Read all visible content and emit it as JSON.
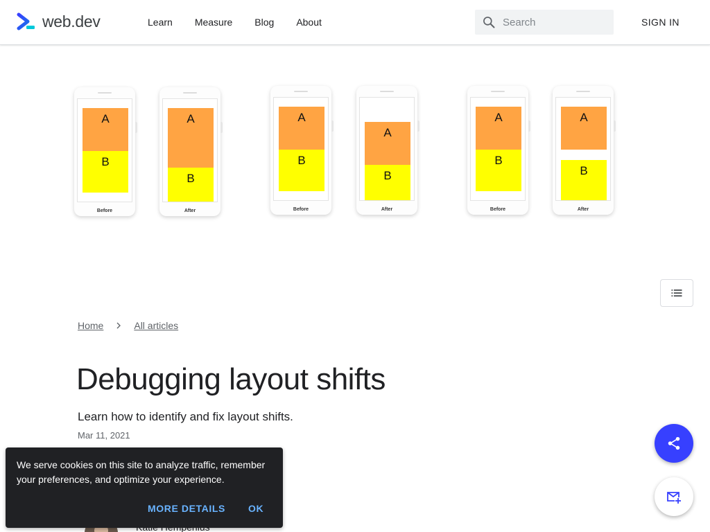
{
  "brand": {
    "name": "web.dev",
    "accent": "#3740ff",
    "logo_teal": "#00c9db"
  },
  "nav": {
    "items": [
      "Learn",
      "Measure",
      "Blog",
      "About"
    ]
  },
  "search": {
    "placeholder": "Search",
    "icon": "search-icon"
  },
  "header": {
    "signin_label": "SIGN IN"
  },
  "hero": {
    "phones": [
      {
        "caption": "Before",
        "block_a": "A",
        "block_b": "B"
      },
      {
        "caption": "After",
        "block_a": "A",
        "block_b": "B"
      },
      {
        "caption": "Before",
        "block_a": "A",
        "block_b": "B"
      },
      {
        "caption": "After",
        "block_a": "A",
        "block_b": "B"
      },
      {
        "caption": "Before",
        "block_a": "A",
        "block_b": "B"
      },
      {
        "caption": "After",
        "block_a": "A",
        "block_b": "B"
      }
    ],
    "colors": {
      "block_a": "#ffa443",
      "block_b": "#ffff00"
    }
  },
  "toc": {
    "icon": "list-icon"
  },
  "breadcrumb": {
    "items": [
      "Home",
      "All articles"
    ]
  },
  "article": {
    "title": "Debugging layout shifts",
    "subtitle": "Learn how to identify and fix layout shifts.",
    "date": "Mar 11, 2021",
    "author": "Katie Hempenius"
  },
  "cookie_banner": {
    "text": "We serve cookies on this site to analyze traffic, remember your preferences, and optimize your experience.",
    "more_label": "MORE DETAILS",
    "ok_label": "OK"
  },
  "fabs": {
    "share_icon": "share-icon",
    "subscribe_icon": "mail-add-icon"
  }
}
